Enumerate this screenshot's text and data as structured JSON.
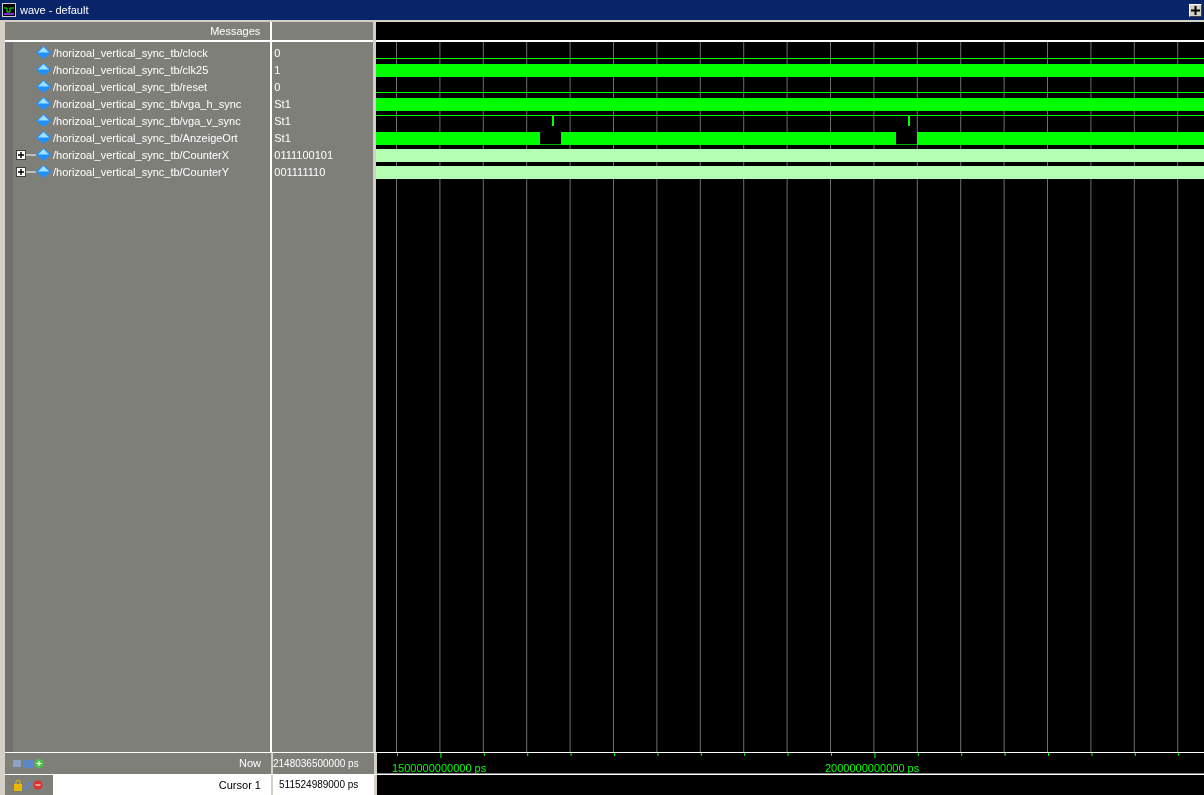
{
  "window": {
    "title": "wave - default"
  },
  "header": {
    "messages": "Messages"
  },
  "signals": [
    {
      "name": "/horizoal_vertical_sync_tb/clock",
      "value": "0",
      "kind": "low"
    },
    {
      "name": "/horizoal_vertical_sync_tb/clk25",
      "value": "1",
      "kind": "dense"
    },
    {
      "name": "/horizoal_vertical_sync_tb/reset",
      "value": "0",
      "kind": "low"
    },
    {
      "name": "/horizoal_vertical_sync_tb/vga_h_sync",
      "value": "St1",
      "kind": "dense"
    },
    {
      "name": "/horizoal_vertical_sync_tb/vga_v_sync",
      "value": "St1",
      "kind": "pulses"
    },
    {
      "name": "/horizoal_vertical_sync_tb/AnzeigeOrt",
      "value": "St1",
      "kind": "gaps"
    },
    {
      "name": "/horizoal_vertical_sync_tb/CounterX",
      "value": "0111100101",
      "kind": "bus",
      "expanded": false
    },
    {
      "name": "/horizoal_vertical_sync_tb/CounterY",
      "value": "001111110",
      "kind": "bus",
      "expanded": false
    }
  ],
  "now": {
    "label": "Now",
    "value": "2148036500000 ps"
  },
  "cursor": {
    "label": "Cursor 1",
    "value": "511524989000 ps"
  },
  "timeline": {
    "ticks": [
      "1500000000000 ps",
      "2000000000000 ps"
    ]
  }
}
